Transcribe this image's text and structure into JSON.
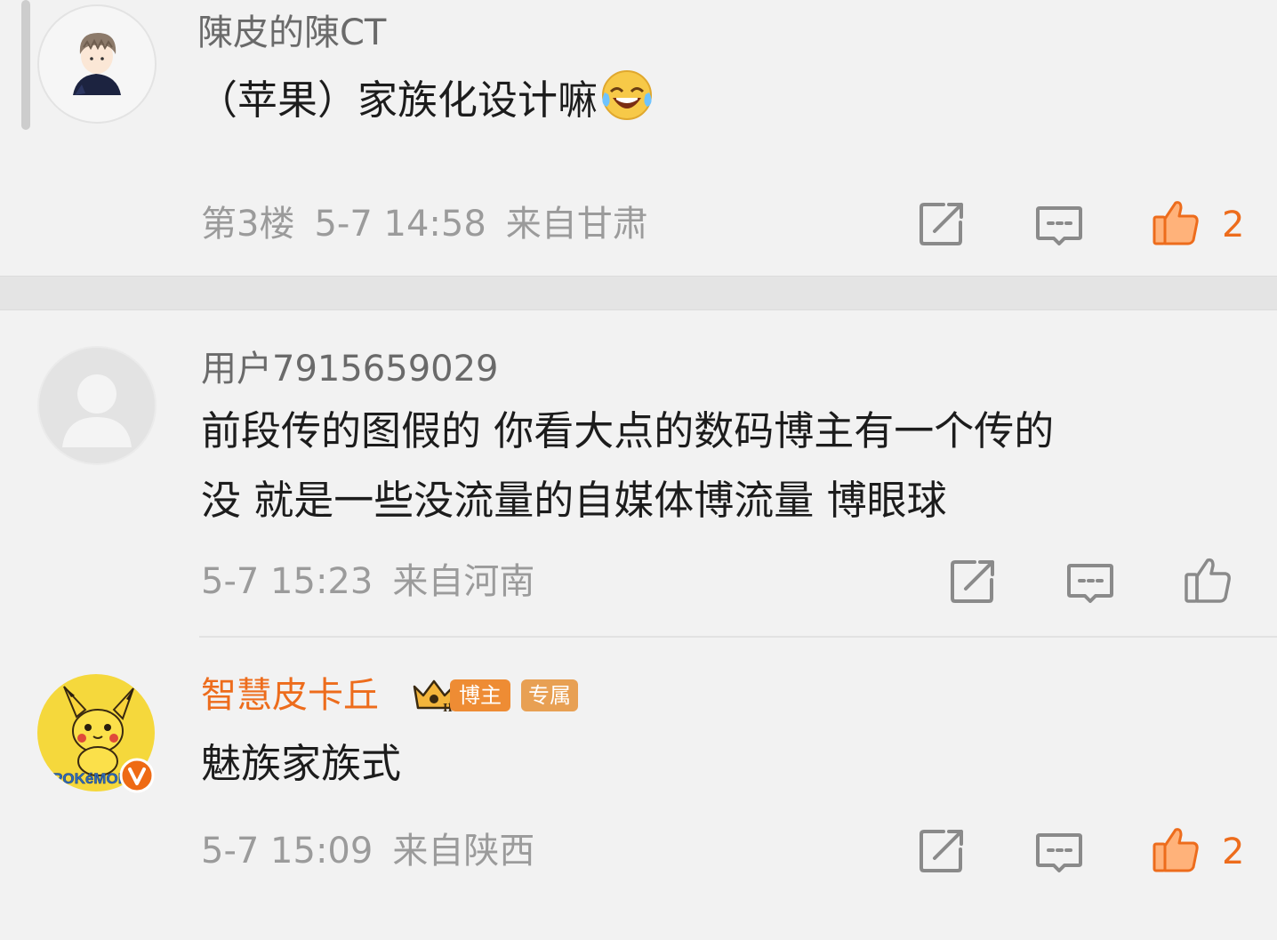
{
  "comments": [
    {
      "username": "陳皮的陳CT",
      "text": "（苹果）家族化设计嘛",
      "floor": "第3楼",
      "time": "5-7 14:58",
      "location": "来自甘肃",
      "likes": "2",
      "liked": true,
      "emoji": "laugh-cry-emoji"
    },
    {
      "username": "用户7915659029",
      "text_lines": [
        "前段传的图假的 你看大点的数码博主有一个传的",
        "没 就是一些没流量的自媒体博流量 博眼球"
      ],
      "time": "5-7 15:23",
      "location": "来自河南",
      "liked": false
    },
    {
      "username": "智慧皮卡丘",
      "badge_level": "II",
      "badge_blogger": "博主",
      "badge_exclusive": "专属",
      "text": "魅族家族式",
      "time": "5-7 15:09",
      "location": "来自陕西",
      "likes": "2",
      "liked": true,
      "avatar_text": "POKéMON"
    }
  ],
  "colors": {
    "accent": "#ed6c1c",
    "meta": "#9b9b9b",
    "background": "#f2f2f2"
  },
  "icons": [
    "share-icon",
    "comment-icon",
    "like-icon",
    "verified-badge-icon",
    "crown-icon"
  ]
}
